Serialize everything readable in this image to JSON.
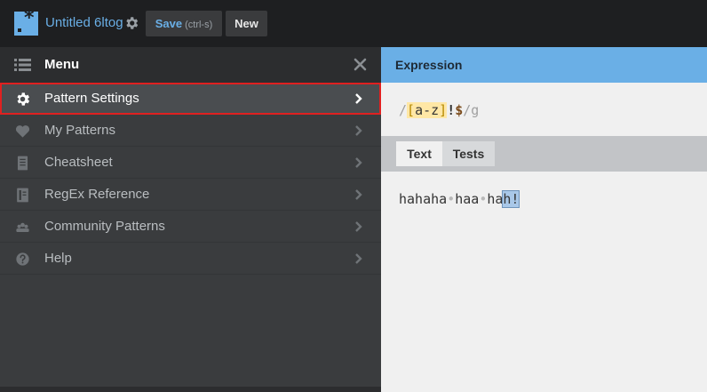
{
  "app": {
    "title": "Untitled 6ltog",
    "save_label": "Save",
    "save_shortcut": "(ctrl-s)",
    "new_label": "New",
    "accent_color": "#6aafe6"
  },
  "menu": {
    "header_label": "Menu",
    "items": [
      {
        "label": "Pattern Settings",
        "icon": "gear-icon",
        "active": true
      },
      {
        "label": "My Patterns",
        "icon": "heart-icon"
      },
      {
        "label": "Cheatsheet",
        "icon": "document-icon"
      },
      {
        "label": "RegEx Reference",
        "icon": "book-icon"
      },
      {
        "label": "Community Patterns",
        "icon": "people-icon"
      },
      {
        "label": "Help",
        "icon": "help-icon"
      }
    ]
  },
  "expression": {
    "header_label": "Expression",
    "open_delim": "/",
    "set_open": "[",
    "set_body": "a-z",
    "set_close": "]",
    "literal": "!",
    "anchor": "$",
    "close_delim": "/",
    "flags": "g"
  },
  "tabs": {
    "text_label": "Text",
    "tests_label": "Tests"
  },
  "sample": {
    "part1": "hahaha",
    "space": "•",
    "part2": "haa",
    "part3_prefix": "ha",
    "match": "h!"
  }
}
